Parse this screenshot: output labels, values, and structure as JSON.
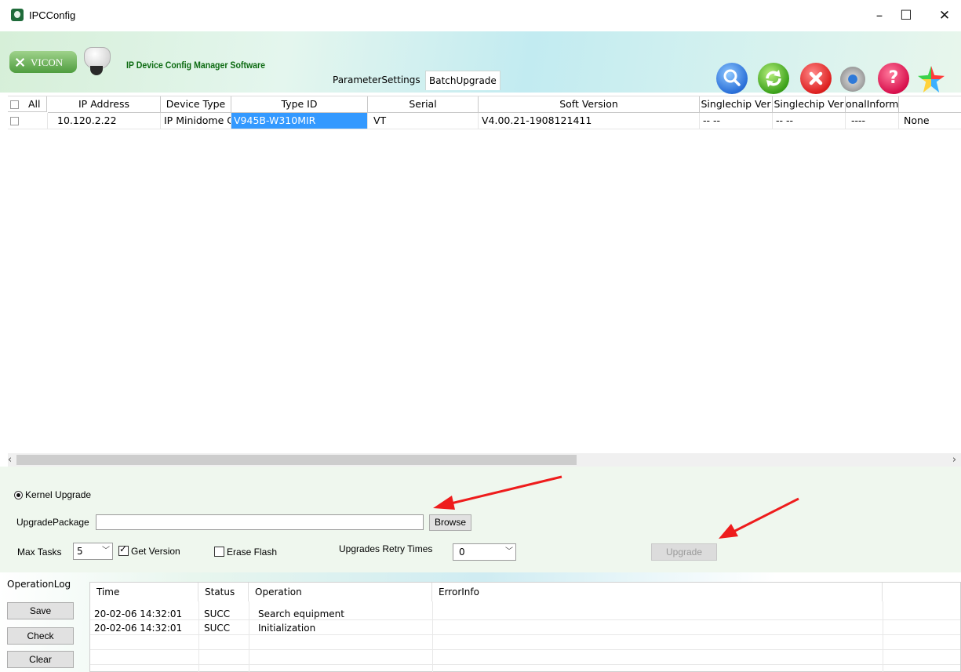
{
  "window": {
    "title": "IPCConfig",
    "minimize": "–",
    "maximize": "☐",
    "close": "✕"
  },
  "banner": {
    "logo_text": "VICON",
    "software_name": "IP Device Config Manager Software",
    "tabs": [
      "ParameterSettings",
      "BatchUpgrade"
    ],
    "active_tab": "BatchUpgrade",
    "toolbar_icons": [
      "search-icon",
      "refresh-icon",
      "stop-icon",
      "settings-icon",
      "help-icon",
      "pinwheel-icon"
    ],
    "help_glyph": "?"
  },
  "grid": {
    "headers": [
      "All",
      "IP Address",
      "Device Type",
      "Type ID",
      "Serial",
      "Soft Version",
      "Singlechip Ver",
      "Singlechip Ver",
      "onalInforma",
      ""
    ],
    "rows": [
      {
        "ip": "10.120.2.22",
        "device_type": "IP Minidome C",
        "type_id": "V945B-W310MIR",
        "serial": "VT",
        "soft_version": "V4.00.21-1908121411",
        "singlechip1": "-- --",
        "singlechip2": "-- --",
        "info": "----",
        "extra": "None"
      }
    ]
  },
  "scroll": {
    "left": "‹",
    "right": "›"
  },
  "options": {
    "kernel_upgrade": "Kernel Upgrade",
    "upgrade_package_label": "UpgradePackage",
    "upgrade_package_value": "",
    "browse": "Browse",
    "max_tasks_label": "Max Tasks",
    "max_tasks_value": "5",
    "get_version": "Get Version",
    "get_version_checked": true,
    "erase_flash": "Erase Flash",
    "erase_flash_checked": false,
    "retry_label": "Upgrades Retry Times",
    "retry_value": "0",
    "upgrade": "Upgrade"
  },
  "log": {
    "title": "OperationLog",
    "buttons": [
      "Save",
      "Check",
      "Clear"
    ],
    "headers": [
      "Time",
      "Status",
      "Operation",
      "ErrorInfo"
    ],
    "rows": [
      {
        "time": "20-02-06 14:32:01",
        "status": "SUCC",
        "operation": "Search equipment",
        "error": ""
      },
      {
        "time": "20-02-06 14:32:01",
        "status": "SUCC",
        "operation": "Initialization",
        "error": ""
      }
    ]
  },
  "colors": {
    "annotation_arrow": "#ee1c1c",
    "selection": "#3399ff",
    "brand_green": "#0d6b12"
  }
}
